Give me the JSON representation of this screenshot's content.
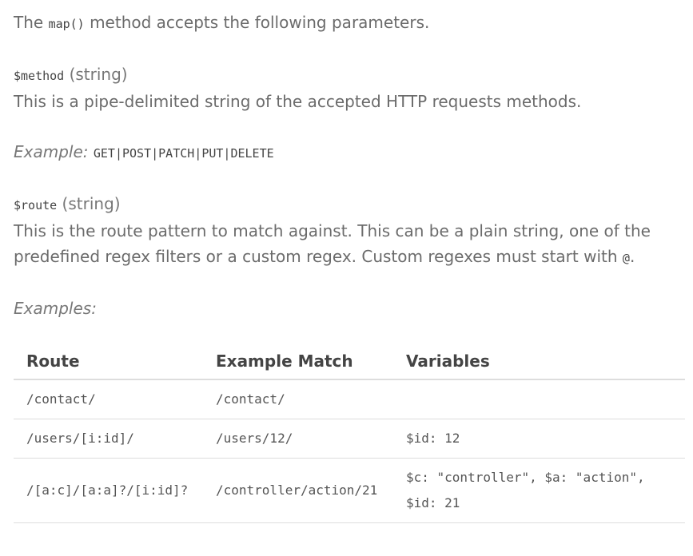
{
  "intro": {
    "before": "The ",
    "code": "map()",
    "after": " method accepts the following parameters."
  },
  "params": [
    {
      "name": "$method",
      "type": "(string)",
      "description": "This is a pipe-delimited string of the accepted HTTP requests methods.",
      "example_label": "Example:",
      "example_value": "GET|POST|PATCH|PUT|DELETE"
    },
    {
      "name": "$route",
      "type": "(string)",
      "description": "This is the route pattern to match against. This can be a plain string, one of the predefined regex filters or a custom regex. Custom regexes must start with ",
      "description_code": "@",
      "description_end": "."
    }
  ],
  "examples_label": "Examples:",
  "table": {
    "headers": [
      "Route",
      "Example Match",
      "Variables"
    ],
    "rows": [
      [
        "/contact/",
        "/contact/",
        ""
      ],
      [
        "/users/[i:id]/",
        "/users/12/",
        "$id: 12"
      ],
      [
        "/[a:c]/[a:a]?/[i:id]?",
        "/controller/action/21",
        "$c: \"controller\", $a: \"action\", $id: 21"
      ]
    ]
  }
}
